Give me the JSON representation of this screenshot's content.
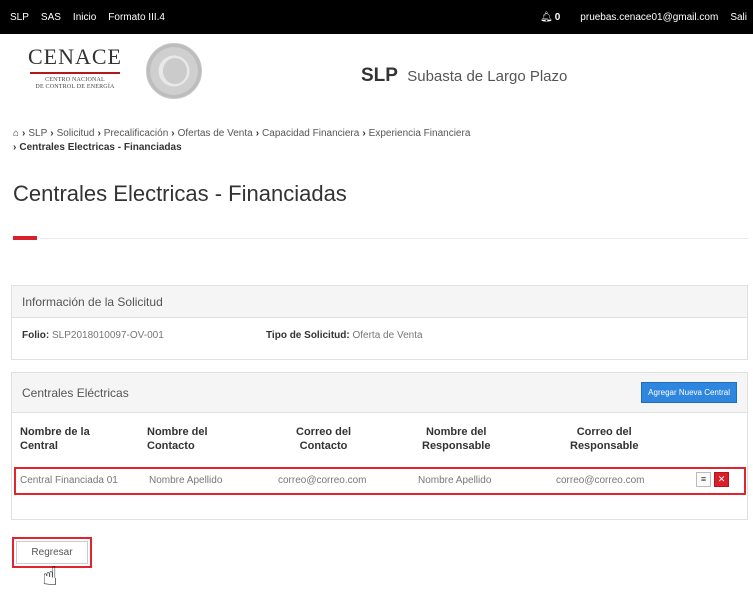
{
  "topnav": {
    "items": [
      "SLP",
      "SAS",
      "Inicio",
      "Formato III.4"
    ],
    "bell_icon": "bell-icon",
    "notification_count": "0",
    "user_email": "pruebas.cenace01@gmail.com",
    "logout_label": "Sali"
  },
  "header": {
    "logo_brand": "CENACE",
    "logo_line1": "CENTRO NACIONAL",
    "logo_line2": "DE CONTROL DE ENERGÍA",
    "app_abbr": "SLP",
    "app_name": "Subasta de Largo Plazo"
  },
  "breadcrumb": {
    "home_icon": "home-icon",
    "items": [
      "SLP",
      "Solicitud",
      "Precalificación",
      "Ofertas de Venta",
      "Capacidad Financiera",
      "Experiencia Financiera"
    ],
    "current": "Centrales Electricas - Financiadas"
  },
  "page": {
    "title": "Centrales Electricas - Financiadas"
  },
  "info_panel": {
    "title": "Información de la Solicitud",
    "folio_label": "Folio:",
    "folio_value": "SLP2018010097-OV-001",
    "tipo_label": "Tipo de Solicitud:",
    "tipo_value": "Oferta de Venta"
  },
  "centrales_panel": {
    "title": "Centrales Eléctricas",
    "add_button": "Agregar Nueva Central",
    "columns": [
      [
        "Nombre de la",
        "Central"
      ],
      [
        "Nombre del",
        "Contacto"
      ],
      [
        "Correo del",
        "Contacto"
      ],
      [
        "Nombre del",
        "Responsable"
      ],
      [
        "Correo del",
        "Responsable"
      ]
    ],
    "rows": [
      {
        "central": "Central Financiada 01",
        "contacto": "Nombre Apellido",
        "correo_contacto": "correo@correo.com",
        "responsable": "Nombre Apellido",
        "correo_responsable": "correo@correo.com"
      }
    ],
    "row_icons": [
      "list-icon",
      "delete-icon"
    ]
  },
  "back_button": "Regresar",
  "colors": {
    "accent_red": "#d9202a",
    "button_blue": "#2e86de",
    "topbar": "#000000"
  }
}
